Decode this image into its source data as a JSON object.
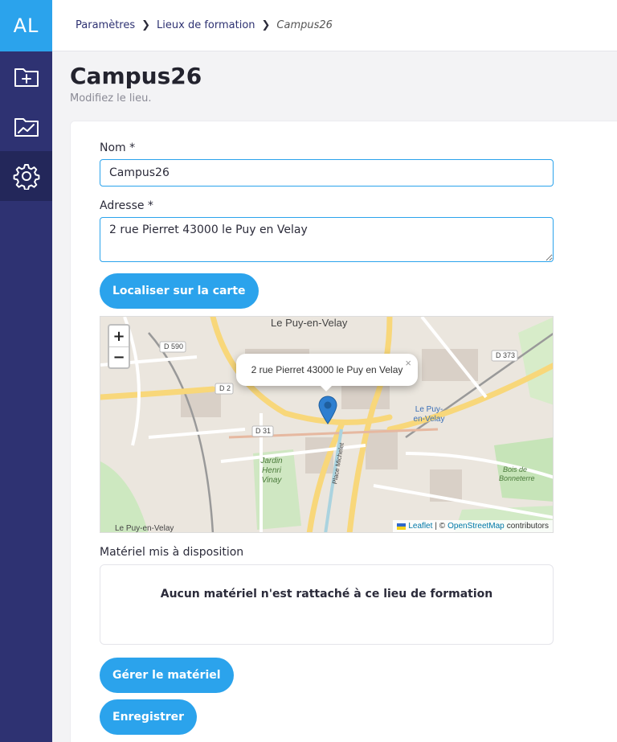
{
  "app": {
    "logo_text": "AL"
  },
  "sidebar": {
    "items": [
      {
        "name": "new-folder",
        "icon": "folder-plus-icon",
        "active": false
      },
      {
        "name": "stats",
        "icon": "chart-folder-icon",
        "active": false
      },
      {
        "name": "settings",
        "icon": "gear-icon",
        "active": true
      }
    ]
  },
  "breadcrumb": {
    "items": [
      "Paramètres",
      "Lieux de formation",
      "Campus26"
    ]
  },
  "page": {
    "title": "Campus26",
    "subtitle": "Modifiez le lieu."
  },
  "form": {
    "name_label": "Nom *",
    "name_value": "Campus26",
    "address_label": "Adresse *",
    "address_value": "2 rue Pierret 43000 le Puy en Velay",
    "locate_button": "Localiser sur la carte"
  },
  "map": {
    "popup_text": "2 rue Pierret 43000 le Puy en Velay",
    "popup_close": "×",
    "zoom_in": "+",
    "zoom_out": "−",
    "attribution": {
      "leaflet": "Leaflet",
      "sep": "| ©",
      "osm": "OpenStreetMap",
      "contrib": "contributors"
    },
    "labels": {
      "city": "Le Puy-en-Velay",
      "city_bottom": "Le Puy-en-Velay",
      "d590": "D 590",
      "d2": "D 2",
      "d31": "D 31",
      "d373": "D 373",
      "station": "Le Puy-en-Velay",
      "jardin": "Jardin Henri Vinay",
      "bois": "Bois de Bonneterre",
      "place": "Place Michelet"
    }
  },
  "materiel": {
    "label": "Matériel mis à disposition",
    "empty_text": "Aucun matériel n'est rattaché à ce lieu de formation",
    "manage_button": "Gérer le matériel"
  },
  "actions": {
    "save_button": "Enregistrer"
  },
  "colors": {
    "primary": "#2ba3ec",
    "sidebar": "#2e3272",
    "sidebar_active": "#23275a"
  }
}
